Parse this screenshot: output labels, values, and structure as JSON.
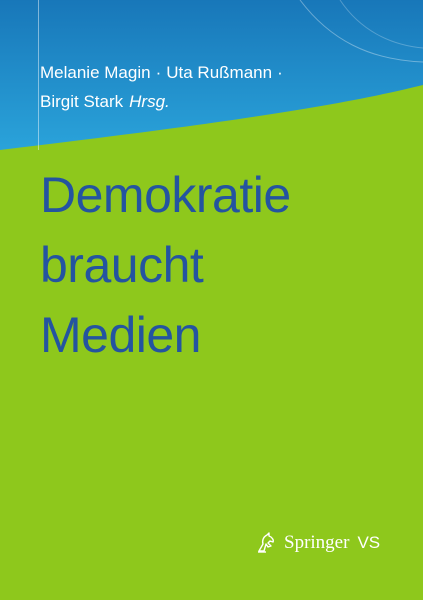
{
  "cover": {
    "colors": {
      "background": "#8ec81c",
      "band_top": "#1877b9",
      "band_bottom": "#2aa3da",
      "title": "#2454a0",
      "text_light": "#ffffff"
    },
    "authors_line1": [
      "Melanie Magin",
      "Uta Rußmann"
    ],
    "authors_line2_name": "Birgit Stark",
    "separator": "·",
    "editor_suffix": "Hrsg.",
    "title_lines": [
      "Demokratie",
      "braucht",
      "Medien"
    ],
    "publisher": {
      "icon": "springer-horse-icon",
      "name": "Springer",
      "imprint": "VS"
    }
  }
}
